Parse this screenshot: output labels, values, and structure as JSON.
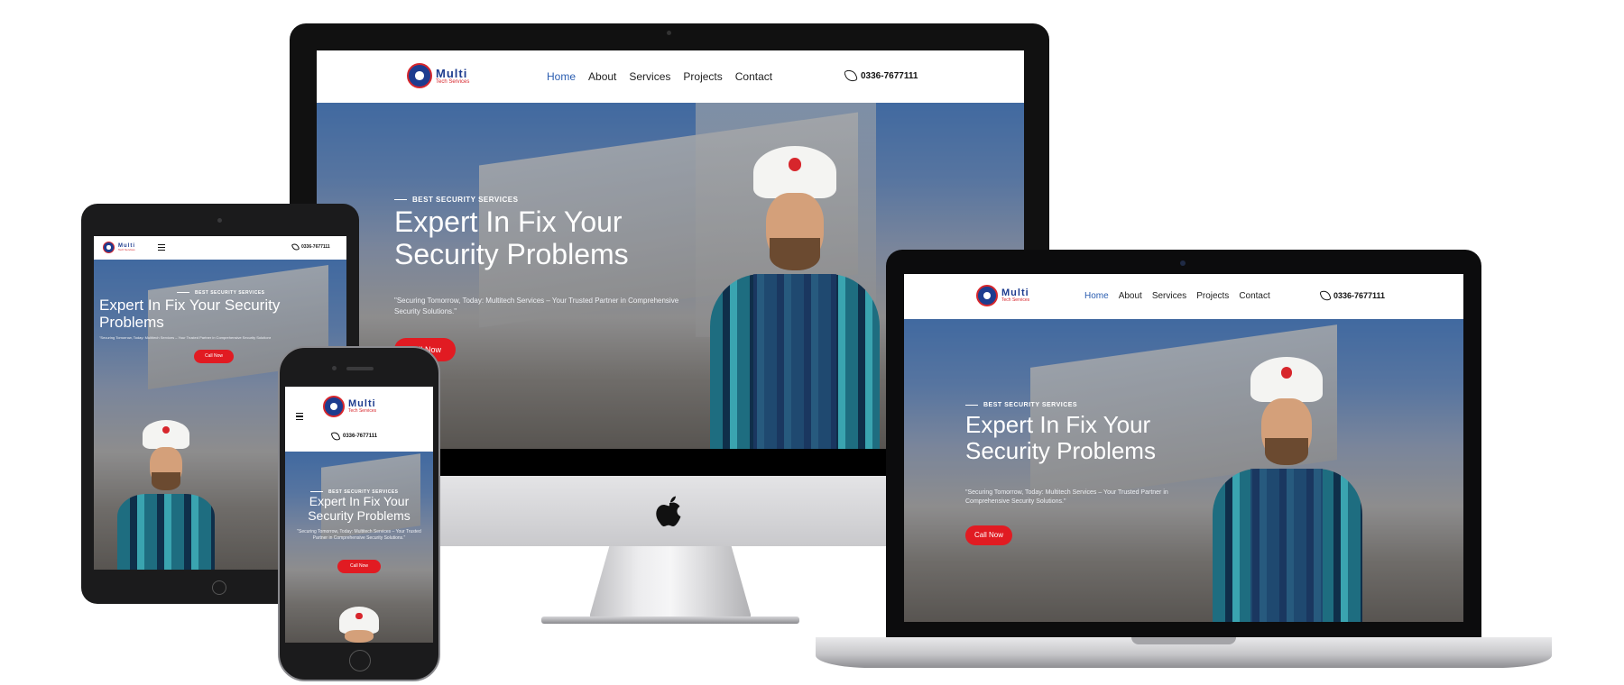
{
  "brand": {
    "name": "Multi",
    "tagline": "Tech Services",
    "colors": {
      "primary": "#1d3c8f",
      "accent": "#e11b22",
      "link_active": "#2a5db0"
    }
  },
  "nav": {
    "items": [
      "Home",
      "About",
      "Services",
      "Projects",
      "Contact"
    ],
    "active": "Home",
    "phone": "0336-7677111",
    "phone_icon": "phone-icon",
    "menu_icon": "hamburger-menu-icon"
  },
  "hero": {
    "eyebrow": "BEST SECURITY SERVICES",
    "headline_imac": [
      "Expert In Fix Your",
      "Security Problems"
    ],
    "headline_tablet": [
      "Expert In Fix Your Security",
      "Problems"
    ],
    "headline_phone": [
      "Expert In Fix Your",
      "Security Problems"
    ],
    "subtext": "\"Securing Tomorrow, Today: Multitech Services – Your Trusted Partner in Comprehensive Security Solutions.\"",
    "cta_label": "Call Now"
  },
  "devices": [
    "imac",
    "laptop",
    "tablet",
    "phone"
  ],
  "device_logo_icon": "apple-logo-icon"
}
